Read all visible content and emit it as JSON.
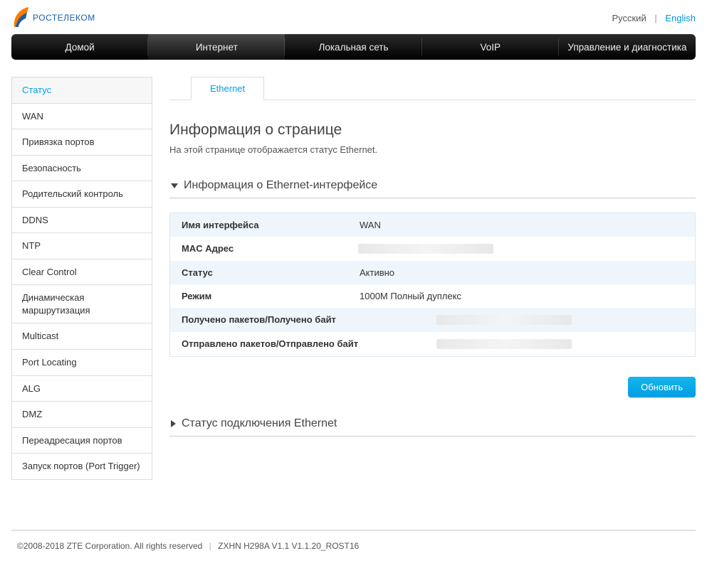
{
  "brand": "РОСТЕЛЕКОМ",
  "lang": {
    "ru": "Русский",
    "en": "English"
  },
  "topnav": {
    "home": "Домой",
    "internet": "Интернет",
    "lan": "Локальная сеть",
    "voip": "VoIP",
    "admin": "Управление и диагностика"
  },
  "sidebar": {
    "status": "Статус",
    "wan": "WAN",
    "portbind": "Привязка портов",
    "security": "Безопасность",
    "parental": "Родительский контроль",
    "ddns": "DDNS",
    "ntp": "NTP",
    "clear": "Clear Control",
    "dynroute": "Динамическая маршрутизация",
    "multicast": "Multicast",
    "portloc": "Port Locating",
    "alg": "ALG",
    "dmz": "DMZ",
    "portfwd": "Переадресация портов",
    "porttrig": "Запуск портов (Port Trigger)"
  },
  "tabs": {
    "ethernet": "Ethernet"
  },
  "page": {
    "title": "Информация о странице",
    "desc": "На этой странице отображается статус Ethernet."
  },
  "section1": {
    "title": "Информация о Ethernet-интерфейсе",
    "rows": {
      "ifname_label": "Имя интерфейса",
      "ifname_value": "WAN",
      "mac_label": "MAC Адрес",
      "mac_value": "",
      "status_label": "Статус",
      "status_value": "Активно",
      "mode_label": "Режим",
      "mode_value": "1000M Полный дуплекс",
      "rx_label": "Получено пакетов/Получено байт",
      "rx_value": "",
      "tx_label": "Отправлено пакетов/Отправлено байт",
      "tx_value": ""
    }
  },
  "buttons": {
    "refresh": "Обновить"
  },
  "section2": {
    "title": "Статус подключения Ethernet"
  },
  "footer": {
    "copyright": "©2008-2018 ZTE Corporation. All rights reserved",
    "model": "ZXHN H298A V1.1 V1.1.20_ROST16"
  }
}
